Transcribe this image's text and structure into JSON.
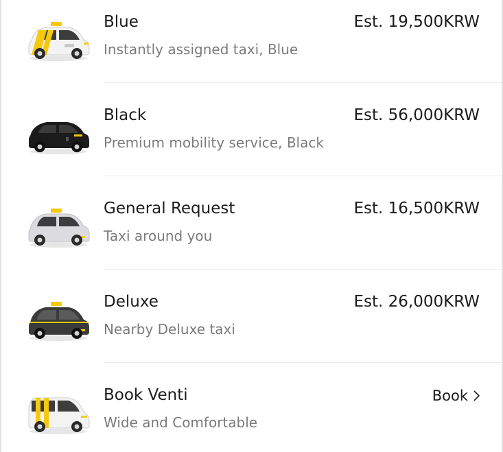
{
  "colors": {
    "accent_yellow": "#f6c90e",
    "title_text": "#1c1c1c",
    "subtitle_text": "#7b7b7b",
    "divider": "#ececec"
  },
  "options": [
    {
      "title": "Blue",
      "subtitle": "Instantly assigned taxi, Blue",
      "price": "Est. 19,500KRW",
      "icon": "blue-taxi-icon"
    },
    {
      "title": "Black",
      "subtitle": "Premium mobility service, Black",
      "price": "Est. 56,000KRW",
      "icon": "black-car-icon"
    },
    {
      "title": "General Request",
      "subtitle": "Taxi around you",
      "price": "Est. 16,500KRW",
      "icon": "general-taxi-icon"
    },
    {
      "title": "Deluxe",
      "subtitle": "Nearby Deluxe taxi",
      "price": "Est. 26,000KRW",
      "icon": "deluxe-taxi-icon"
    },
    {
      "title": "Book Venti",
      "subtitle": "Wide and Comfortable",
      "action": "Book",
      "icon": "venti-van-icon"
    }
  ]
}
